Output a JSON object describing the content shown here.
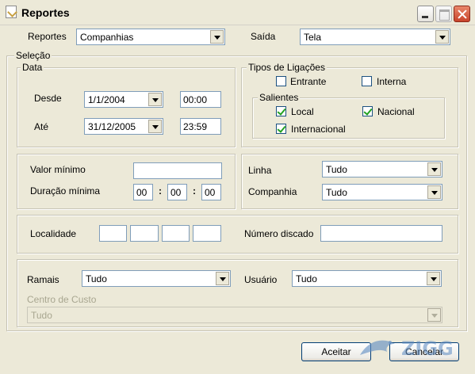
{
  "window": {
    "title": "Reportes"
  },
  "top": {
    "reportes_label": "Reportes",
    "reportes_value": "Companhias",
    "saida_label": "Saída",
    "saida_value": "Tela"
  },
  "selecao": {
    "legend": "Seleção",
    "data": {
      "legend": "Data",
      "desde_label": "Desde",
      "desde_date": "1/1/2004",
      "desde_time": "00:00",
      "ate_label": "Até",
      "ate_date": "31/12/2005",
      "ate_time": "23:59"
    },
    "tipos": {
      "legend": "Tipos de Ligações",
      "entrante_label": "Entrante",
      "entrante_checked": false,
      "interna_label": "Interna",
      "interna_checked": false,
      "salientes": {
        "legend": "Salientes",
        "local_label": "Local",
        "local_checked": true,
        "nacional_label": "Nacional",
        "nacional_checked": true,
        "internacional_label": "Internacional",
        "internacional_checked": true
      }
    },
    "valores": {
      "valor_minimo_label": "Valor mínimo",
      "valor_minimo_value": "",
      "duracao_minima_label": "Duração mínima",
      "dur_h": "00",
      "dur_m": "00",
      "dur_s": "00",
      "sep": ":"
    },
    "linha": {
      "linha_label": "Linha",
      "linha_value": "Tudo",
      "companhia_label": "Companhia",
      "companhia_value": "Tudo"
    },
    "localidade": {
      "localidade_label": "Localidade",
      "numero_discado_label": "Número discado",
      "numero_discado_value": ""
    },
    "ramais": {
      "ramais_label": "Ramais",
      "ramais_value": "Tudo",
      "usuario_label": "Usuário",
      "usuario_value": "Tudo",
      "centro_label": "Centro de Custo",
      "centro_value": "Tudo"
    }
  },
  "buttons": {
    "aceitar": "Aceitar",
    "cancelar": "Cancelar"
  },
  "watermark_text": "ZIGG",
  "colors": {
    "checkmark": "#21a121",
    "combo_border": "#7f9db9",
    "dialog_bg": "#ece9d8",
    "close_button": "#c8432a"
  }
}
